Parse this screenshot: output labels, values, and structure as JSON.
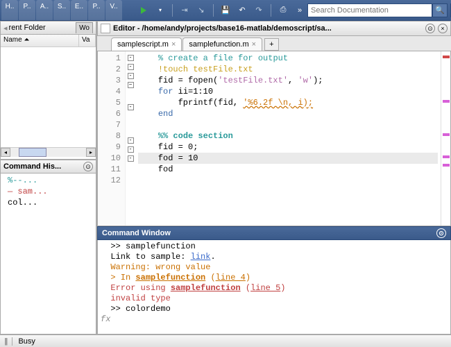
{
  "toolbar": {
    "tabs": [
      "H..",
      "P..",
      "A..",
      "S..",
      "E..",
      "P..",
      "V.."
    ],
    "search_placeholder": "Search Documentation"
  },
  "current_folder": {
    "title": "rent Folder",
    "side_tab": "Wo",
    "columns": [
      "Name ⏶",
      "Va"
    ]
  },
  "cmd_history": {
    "title": "Command His...",
    "items": [
      {
        "text": "%--...",
        "cls": "hist-pct"
      },
      {
        "text": "sam...",
        "cls": "hist-dash",
        "prefix": "— "
      },
      {
        "text": "col...",
        "cls": ""
      }
    ]
  },
  "editor": {
    "title": "Editor - /home/andy/projects/base16-matlab/demoscript/sa...",
    "tabs": [
      {
        "name": "samplescript.m",
        "active": true
      },
      {
        "name": "samplefunction.m",
        "active": false
      }
    ],
    "lines": [
      {
        "n": 1,
        "fold": "-",
        "segs": [
          {
            "t": "    ",
            "c": ""
          },
          {
            "t": "% create a file for output",
            "c": "c-comment"
          }
        ],
        "hl": false,
        "mk": "mk-red"
      },
      {
        "n": 2,
        "fold": "-",
        "segs": [
          {
            "t": "    ",
            "c": ""
          },
          {
            "t": "!",
            "c": "c-sys"
          },
          {
            "t": "touch testFile.txt",
            "c": "c-sys"
          }
        ],
        "hl": false
      },
      {
        "n": 3,
        "fold": "-",
        "segs": [
          {
            "t": "    fid = fopen(",
            "c": ""
          },
          {
            "t": "'testFile.txt'",
            "c": "c-str"
          },
          {
            "t": ", ",
            "c": ""
          },
          {
            "t": "'w'",
            "c": "c-str"
          },
          {
            "t": ");",
            "c": ""
          }
        ],
        "hl": false
      },
      {
        "n": 4,
        "fold": "⊟",
        "segs": [
          {
            "t": "    ",
            "c": ""
          },
          {
            "t": "for",
            "c": "c-kw"
          },
          {
            "t": " ii=1:10",
            "c": ""
          }
        ],
        "hl": false
      },
      {
        "n": 5,
        "fold": "",
        "segs": [
          {
            "t": "        fprintf(fid, ",
            "c": ""
          },
          {
            "t": "'%6.2f \\n, i);",
            "c": "c-unf"
          }
        ],
        "hl": false,
        "mk": "mk-mag"
      },
      {
        "n": 6,
        "fold": "-",
        "segs": [
          {
            "t": "    ",
            "c": ""
          },
          {
            "t": "end",
            "c": "c-kw"
          }
        ],
        "hl": false
      },
      {
        "n": 7,
        "fold": "",
        "segs": [
          {
            "t": "",
            "c": ""
          }
        ],
        "hl": false
      },
      {
        "n": 8,
        "fold": "",
        "segs": [
          {
            "t": "    ",
            "c": ""
          },
          {
            "t": "%% code section",
            "c": "c-section"
          }
        ],
        "hl": false,
        "mk": "mk-mag"
      },
      {
        "n": 9,
        "fold": "-",
        "segs": [
          {
            "t": "    fid = 0;",
            "c": ""
          }
        ],
        "hl": false
      },
      {
        "n": 10,
        "fold": "-",
        "segs": [
          {
            "t": "    fod = 10",
            "c": ""
          }
        ],
        "hl": true,
        "mk": "mk-mag"
      },
      {
        "n": 11,
        "fold": "-",
        "segs": [
          {
            "t": "    fod",
            "c": ""
          }
        ],
        "hl": false,
        "mk": "mk-mag"
      },
      {
        "n": 12,
        "fold": "",
        "segs": [
          {
            "t": "",
            "c": ""
          }
        ],
        "hl": false
      }
    ]
  },
  "cmd_window": {
    "title": "Command Window",
    "lines": [
      {
        "segs": [
          {
            "t": "  >> samplefunction",
            "c": ""
          }
        ]
      },
      {
        "segs": [
          {
            "t": "  Link to sample: ",
            "c": ""
          },
          {
            "t": "link",
            "c": "cw-link"
          },
          {
            "t": ".",
            "c": ""
          }
        ]
      },
      {
        "segs": [
          {
            "t": "  Warning: wrong value",
            "c": "cw-warn"
          }
        ]
      },
      {
        "segs": [
          {
            "t": "  > In ",
            "c": "cw-warn"
          },
          {
            "t": "samplefunction",
            "c": "cw-warn cw-bold"
          },
          {
            "t": " (",
            "c": "cw-warn"
          },
          {
            "t": "line 4",
            "c": "cw-warn cw-link"
          },
          {
            "t": ")",
            "c": "cw-warn"
          }
        ]
      },
      {
        "segs": [
          {
            "t": "  Error using ",
            "c": "cw-err"
          },
          {
            "t": "samplefunction",
            "c": "cw-err cw-bold"
          },
          {
            "t": " (",
            "c": "cw-err"
          },
          {
            "t": "line 5",
            "c": "cw-err cw-link"
          },
          {
            "t": ")",
            "c": "cw-err"
          }
        ]
      },
      {
        "segs": [
          {
            "t": "  invalid type",
            "c": "cw-err"
          }
        ]
      },
      {
        "segs": [
          {
            "t": "  >> colordemo",
            "c": ""
          }
        ]
      }
    ],
    "prompt": "fx"
  },
  "status": {
    "text": "Busy"
  }
}
